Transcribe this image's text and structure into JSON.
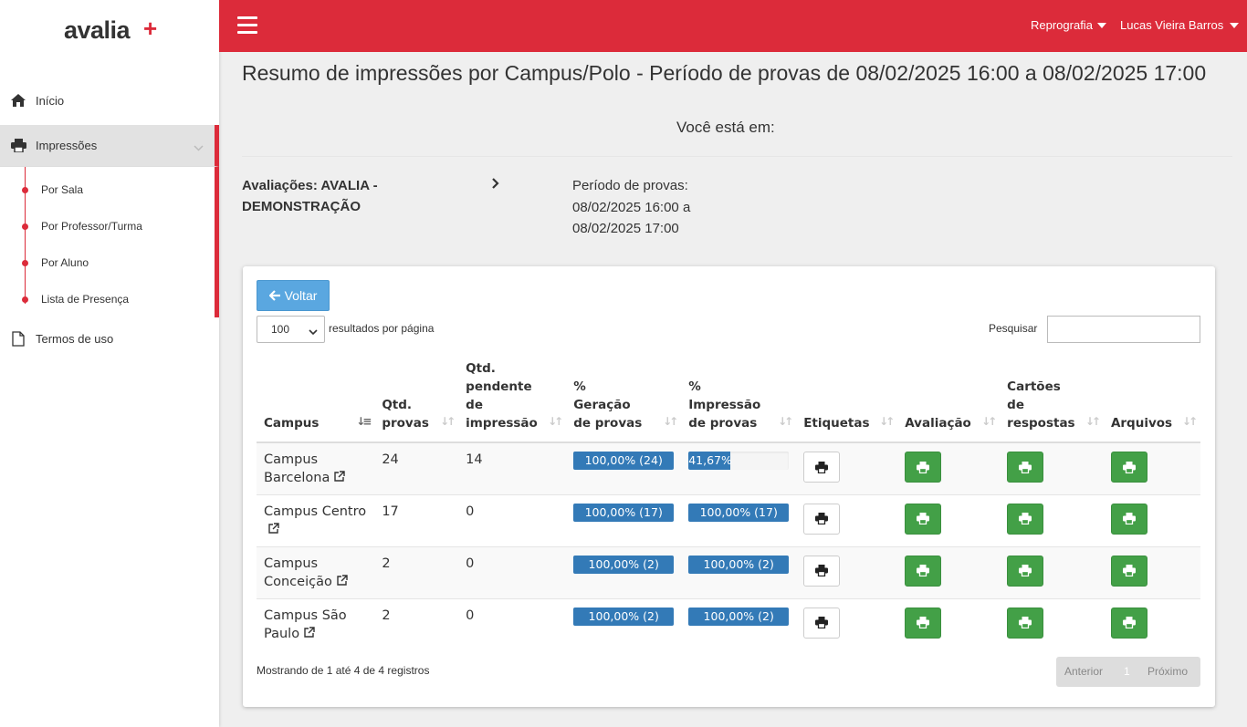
{
  "brand": {
    "logo_text": "avalia",
    "logo_plus": "+"
  },
  "sidebar": {
    "inicio": "Início",
    "impressoes": "Impressões",
    "submenu": [
      "Por Sala",
      "Por Professor/Turma",
      "Por Aluno",
      "Lista de Presença"
    ],
    "termos": "Termos de uso"
  },
  "topbar": {
    "menu1": "Reprografia",
    "menu2": "Lucas Vieira Barros"
  },
  "header": {
    "title": "Resumo de impressões por Campus/Polo - Período de provas de 08/02/2025 16:00 a 08/02/2025 17:00",
    "breadcrumb_label": "Você está em:",
    "avaliacoes": "Avaliações: AVALIA - DEMONSTRAÇÃO",
    "periodo_line1": "Período de provas:",
    "periodo_line2": "08/02/2025 16:00 a",
    "periodo_line3": "08/02/2025 17:00"
  },
  "panel": {
    "voltar": "Voltar",
    "page_length": "100",
    "length_label": "resultados por página",
    "search_label": "Pesquisar",
    "search_value": "",
    "columns": [
      "Campus",
      "Qtd. provas",
      "Qtd. pendente de impressão",
      "% Geração de provas",
      "% Impressão de provas",
      "Etiquetas",
      "Avaliação",
      "Cartões de respostas",
      "Arquivos"
    ],
    "rows": [
      {
        "campus": "Campus Barcelona",
        "qtd": "24",
        "pendente": "14",
        "geracao": "100,00% (24)",
        "geracao_pct": 100,
        "impressao": "41,67%",
        "impressao_pct": 41.67
      },
      {
        "campus": "Campus Centro",
        "qtd": "17",
        "pendente": "0",
        "geracao": "100,00% (17)",
        "geracao_pct": 100,
        "impressao": "100,00% (17)",
        "impressao_pct": 100
      },
      {
        "campus": "Campus Conceição",
        "qtd": "2",
        "pendente": "0",
        "geracao": "100,00% (2)",
        "geracao_pct": 100,
        "impressao": "100,00% (2)",
        "impressao_pct": 100
      },
      {
        "campus": "Campus São Paulo",
        "qtd": "2",
        "pendente": "0",
        "geracao": "100,00% (2)",
        "geracao_pct": 100,
        "impressao": "100,00% (2)",
        "impressao_pct": 100
      }
    ],
    "info": "Mostrando de 1 até 4 de 4 registros",
    "pager": {
      "prev": "Anterior",
      "current": "1",
      "next": "Próximo"
    }
  },
  "colors": {
    "brand_red": "#dc2b3a",
    "progress_blue": "#337ab7",
    "button_green": "#43a047",
    "voltar_blue": "#5aa7e0"
  }
}
